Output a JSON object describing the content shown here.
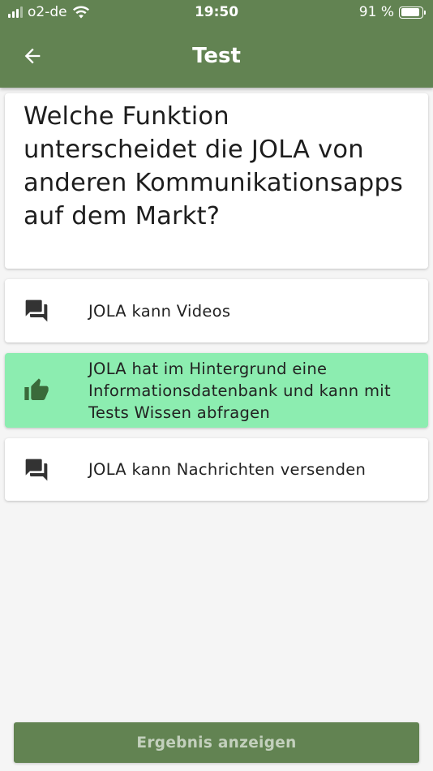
{
  "status_bar": {
    "carrier": "o2-de",
    "time": "19:50",
    "battery_text": "91 %",
    "battery_level": 0.91
  },
  "header": {
    "title": "Test",
    "back_icon": "arrow-left-icon"
  },
  "question": {
    "text": "Welche Funktion unterscheidet die JOLA von anderen Kommunikationsapps auf dem Markt?"
  },
  "answers": [
    {
      "label": "JOLA kann Videos",
      "icon": "chat-bubbles-icon",
      "selected": false
    },
    {
      "label": "JOLA hat im Hintergrund eine Informationsdatenbank und kann mit Tests Wissen abfragen",
      "icon": "thumbs-up-icon",
      "selected": true
    },
    {
      "label": "JOLA kann Nachrichten versenden",
      "icon": "chat-bubbles-icon",
      "selected": false
    }
  ],
  "footer": {
    "result_button_label": "Ergebnis anzeigen"
  },
  "colors": {
    "primary": "#628352",
    "selected_answer": "#8cedb0",
    "background": "#f5f5f5"
  }
}
